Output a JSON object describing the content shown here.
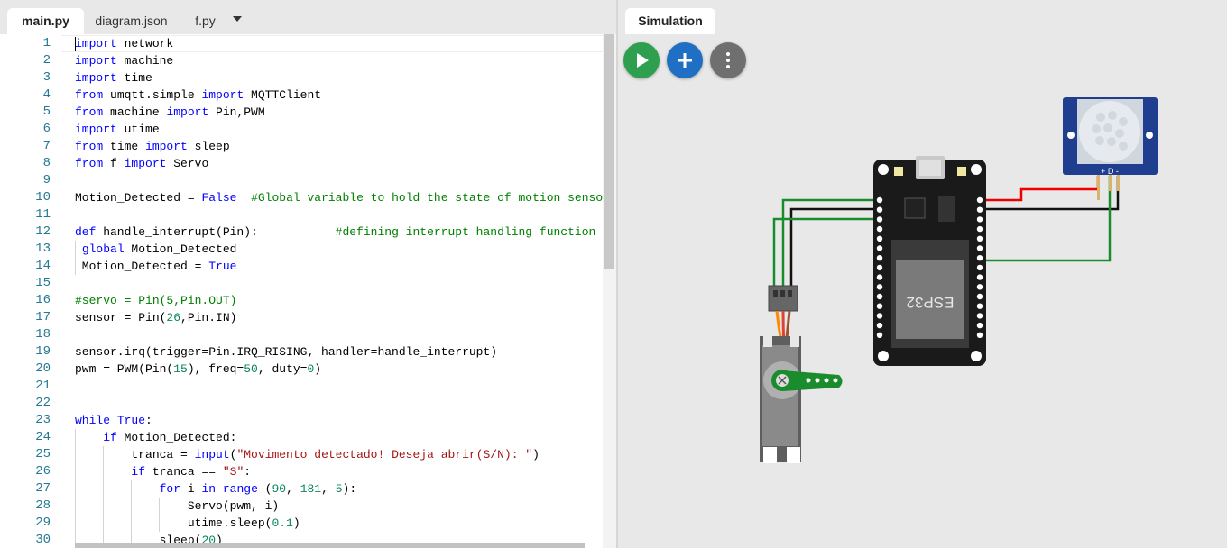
{
  "editor": {
    "tabs": [
      {
        "label": "main.py",
        "active": true
      },
      {
        "label": "diagram.json",
        "active": false
      },
      {
        "label": "f.py",
        "active": false
      }
    ],
    "line_numbers": [
      "1",
      "2",
      "3",
      "4",
      "5",
      "6",
      "7",
      "8",
      "9",
      "10",
      "11",
      "12",
      "13",
      "14",
      "15",
      "16",
      "17",
      "18",
      "19",
      "20",
      "21",
      "22",
      "23",
      "24",
      "25",
      "26",
      "27",
      "28",
      "29",
      "30"
    ],
    "code_lines": [
      [
        {
          "t": "import",
          "c": "kw"
        },
        {
          "t": " network"
        }
      ],
      [
        {
          "t": "import",
          "c": "kw"
        },
        {
          "t": " machine"
        }
      ],
      [
        {
          "t": "import",
          "c": "kw"
        },
        {
          "t": " time"
        }
      ],
      [
        {
          "t": "from",
          "c": "kw"
        },
        {
          "t": " umqtt.simple "
        },
        {
          "t": "import",
          "c": "kw"
        },
        {
          "t": " MQTTClient"
        }
      ],
      [
        {
          "t": "from",
          "c": "kw"
        },
        {
          "t": " machine "
        },
        {
          "t": "import",
          "c": "kw"
        },
        {
          "t": " Pin,PWM"
        }
      ],
      [
        {
          "t": "import",
          "c": "kw"
        },
        {
          "t": " utime"
        }
      ],
      [
        {
          "t": "from",
          "c": "kw"
        },
        {
          "t": " time "
        },
        {
          "t": "import",
          "c": "kw"
        },
        {
          "t": " sleep"
        }
      ],
      [
        {
          "t": "from",
          "c": "kw"
        },
        {
          "t": " f "
        },
        {
          "t": "import",
          "c": "kw"
        },
        {
          "t": " Servo"
        }
      ],
      [],
      [
        {
          "t": "Motion_Detected = "
        },
        {
          "t": "False",
          "c": "kw"
        },
        {
          "t": "  "
        },
        {
          "t": "#Global variable to hold the state of motion sensor",
          "c": "cm"
        }
      ],
      [],
      [
        {
          "t": "def",
          "c": "kw"
        },
        {
          "t": " handle_interrupt(Pin):           "
        },
        {
          "t": "#defining interrupt handling function",
          "c": "cm"
        }
      ],
      [
        {
          "t": " "
        },
        {
          "t": "global",
          "c": "kw"
        },
        {
          "t": " Motion_Detected"
        }
      ],
      [
        {
          "t": " Motion_Detected = "
        },
        {
          "t": "True",
          "c": "kw"
        }
      ],
      [],
      [
        {
          "t": "#servo = Pin(5,Pin.OUT)",
          "c": "cm"
        }
      ],
      [
        {
          "t": "sensor = Pin("
        },
        {
          "t": "26",
          "c": "nm"
        },
        {
          "t": ",Pin.IN)"
        }
      ],
      [],
      [
        {
          "t": "sensor.irq(trigger=Pin.IRQ_RISING, handler=handle_interrupt)"
        }
      ],
      [
        {
          "t": "pwm = PWM(Pin("
        },
        {
          "t": "15",
          "c": "nm"
        },
        {
          "t": "), freq="
        },
        {
          "t": "50",
          "c": "nm"
        },
        {
          "t": ", duty="
        },
        {
          "t": "0",
          "c": "nm"
        },
        {
          "t": ")"
        }
      ],
      [],
      [],
      [
        {
          "t": "while",
          "c": "kw"
        },
        {
          "t": " "
        },
        {
          "t": "True",
          "c": "kw"
        },
        {
          "t": ":"
        }
      ],
      [
        {
          "t": "    "
        },
        {
          "t": "if",
          "c": "kw"
        },
        {
          "t": " Motion_Detected:"
        }
      ],
      [
        {
          "t": "        tranca = "
        },
        {
          "t": "input",
          "c": "kw"
        },
        {
          "t": "("
        },
        {
          "t": "\"Movimento detectado! Deseja abrir(S/N): \"",
          "c": "st"
        },
        {
          "t": ")"
        }
      ],
      [
        {
          "t": "        "
        },
        {
          "t": "if",
          "c": "kw"
        },
        {
          "t": " tranca == "
        },
        {
          "t": "\"S\"",
          "c": "st"
        },
        {
          "t": ":"
        }
      ],
      [
        {
          "t": "            "
        },
        {
          "t": "for",
          "c": "kw"
        },
        {
          "t": " i "
        },
        {
          "t": "in",
          "c": "kw"
        },
        {
          "t": " "
        },
        {
          "t": "range",
          "c": "kw"
        },
        {
          "t": " ("
        },
        {
          "t": "90",
          "c": "nm"
        },
        {
          "t": ", "
        },
        {
          "t": "181",
          "c": "nm"
        },
        {
          "t": ", "
        },
        {
          "t": "5",
          "c": "nm"
        },
        {
          "t": "):"
        }
      ],
      [
        {
          "t": "                Servo(pwm, i)"
        }
      ],
      [
        {
          "t": "                utime.sleep("
        },
        {
          "t": "0.1",
          "c": "nm"
        },
        {
          "t": ")"
        }
      ],
      [
        {
          "t": "            sleep("
        },
        {
          "t": "20",
          "c": "nm"
        },
        {
          "t": ")"
        }
      ]
    ]
  },
  "simulation": {
    "tab_label": "Simulation",
    "buttons": [
      {
        "name": "play-button",
        "icon": "play-icon",
        "color": "#2e9e4f"
      },
      {
        "name": "add-part-button",
        "icon": "plus-icon",
        "color": "#1f6fc4"
      },
      {
        "name": "more-options-button",
        "icon": "kebab-menu-icon",
        "color": "#6f6f6f"
      }
    ],
    "board_label": "ESP32",
    "pir_pin_labels": "+ D -"
  }
}
